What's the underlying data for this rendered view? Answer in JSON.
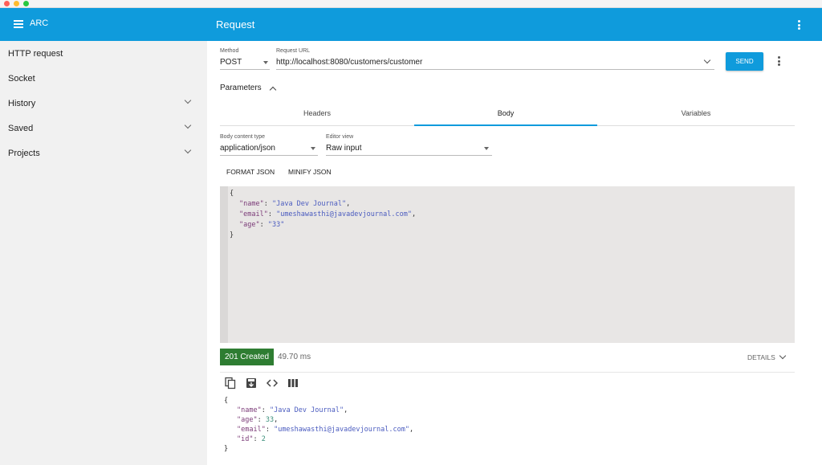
{
  "app": {
    "name": "ARC",
    "title": "Request"
  },
  "sidebar": {
    "items": [
      {
        "label": "HTTP request"
      },
      {
        "label": "Socket"
      },
      {
        "label": "History"
      },
      {
        "label": "Saved"
      },
      {
        "label": "Projects"
      }
    ]
  },
  "request": {
    "method_label": "Method",
    "method": "POST",
    "url_label": "Request URL",
    "url": "http://localhost:8080/customers/customer",
    "send_label": "SEND"
  },
  "parameters": {
    "label": "Parameters",
    "tabs": [
      {
        "label": "Headers"
      },
      {
        "label": "Body"
      },
      {
        "label": "Variables"
      }
    ],
    "active_tab": "Body"
  },
  "body": {
    "content_type_label": "Body content type",
    "content_type": "application/json",
    "editor_view_label": "Editor view",
    "editor_view": "Raw input",
    "format_json": "FORMAT JSON",
    "minify_json": "MINIFY JSON",
    "editor_code": {
      "open": "{",
      "name_key": "\"name\"",
      "name_val": "\"Java Dev Journal\"",
      "email_key": "\"email\"",
      "email_val": "\"umeshawasthi@javadevjournal.com\"",
      "age_key": "\"age\"",
      "age_val": "\"33\"",
      "close": "}"
    }
  },
  "response": {
    "status": "201 Created",
    "time": "49.70 ms",
    "details_label": "DETAILS",
    "actions": [
      "copy-icon",
      "save-icon",
      "code-icon",
      "columns-icon"
    ],
    "json": {
      "open": "{",
      "name_key": "\"name\"",
      "name_val": "\"Java Dev Journal\"",
      "age_key": "\"age\"",
      "age_val": "33",
      "email_key": "\"email\"",
      "email_val": "\"umeshawasthi@javadevjournal.com\"",
      "id_key": "\"id\"",
      "id_val": "2",
      "close": "}"
    }
  },
  "colors": {
    "primary": "#0f9bdc",
    "status_success": "#2e7d32",
    "sidebar_bg": "#f1f1f1",
    "editor_bg": "#e8e6e5"
  }
}
